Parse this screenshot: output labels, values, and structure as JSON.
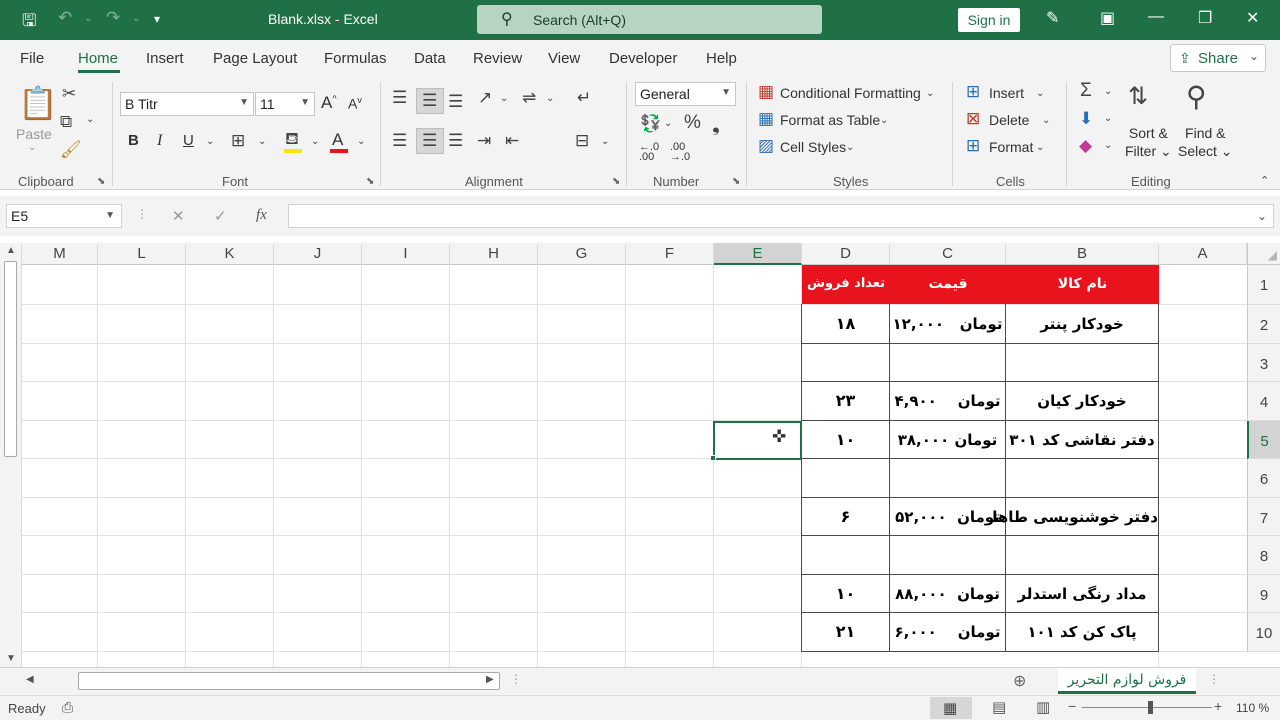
{
  "titlebar": {
    "file_title": "Blank.xlsx  -  Excel",
    "search_placeholder": "Search (Alt+Q)",
    "sign_in": "Sign in"
  },
  "menu": {
    "tabs": [
      "File",
      "Home",
      "Insert",
      "Page Layout",
      "Formulas",
      "Data",
      "Review",
      "View",
      "Developer",
      "Help"
    ],
    "active_tab": "Home",
    "share_label": "Share"
  },
  "ribbon": {
    "clipboard": {
      "label": "Clipboard",
      "paste": "Paste"
    },
    "font": {
      "label": "Font",
      "font_name": "B Titr",
      "font_size": "11",
      "bold": "B",
      "italic": "I",
      "underline": "U",
      "grow": "A",
      "shrink": "A"
    },
    "alignment": {
      "label": "Alignment"
    },
    "number": {
      "label": "Number",
      "format": "General"
    },
    "styles": {
      "label": "Styles",
      "conditional_formatting": "Conditional Formatting",
      "format_as_table": "Format as Table",
      "cell_styles": "Cell Styles"
    },
    "cells": {
      "label": "Cells",
      "insert": "Insert",
      "delete": "Delete",
      "format": "Format"
    },
    "editing": {
      "label": "Editing",
      "sort_filter_1": "Sort &",
      "sort_filter_2": "Filter",
      "find_select_1": "Find &",
      "find_select_2": "Select"
    }
  },
  "formula_bar": {
    "name_box": "E5",
    "fx": "fx",
    "value": ""
  },
  "grid": {
    "columns": [
      "M",
      "L",
      "K",
      "J",
      "I",
      "H",
      "G",
      "F",
      "E",
      "D",
      "C",
      "B",
      "A"
    ],
    "rows": [
      "1",
      "2",
      "3",
      "4",
      "5",
      "6",
      "7",
      "8",
      "9",
      "10"
    ],
    "selected_column": "E",
    "selected_row": "5",
    "selected_cell": "E5"
  },
  "table": {
    "headers": {
      "name": "نام کالا",
      "price": "قیمت",
      "count": "تعداد فروش"
    },
    "rows": [
      {
        "row": "2",
        "name": "خودکار پنتر",
        "price": "۱۲,۰۰۰",
        "currency": "تومان",
        "count": "۱۸"
      },
      {
        "row": "3",
        "name": "",
        "price": "",
        "currency": "",
        "count": ""
      },
      {
        "row": "4",
        "name": "خودکار کیان",
        "price": "۴,۹۰۰",
        "currency": "تومان",
        "count": "۲۳"
      },
      {
        "row": "5",
        "name": "دفتر نقاشی کد ۳۰۱",
        "price": "۳۸,۰۰۰",
        "currency": "تومان",
        "count": "۱۰"
      },
      {
        "row": "6",
        "name": "",
        "price": "",
        "currency": "",
        "count": ""
      },
      {
        "row": "7",
        "name": "دفتر خوشنویسی طاها",
        "price": "۵۲,۰۰۰",
        "currency": "تومان",
        "count": "۶"
      },
      {
        "row": "8",
        "name": "",
        "price": "",
        "currency": "",
        "count": ""
      },
      {
        "row": "9",
        "name": "مداد رنگی استدلر",
        "price": "۸۸,۰۰۰",
        "currency": "تومان",
        "count": "۱۰"
      },
      {
        "row": "10",
        "name": "پاک کن کد ۱۰۱",
        "price": "۶,۰۰۰",
        "currency": "تومان",
        "count": "۲۱"
      }
    ]
  },
  "sheet_tab": "فروش لوازم التحریر",
  "status": {
    "ready": "Ready",
    "zoom": "110 %"
  },
  "colors": {
    "excel_green": "#1f7145",
    "header_red": "#e8131c"
  }
}
